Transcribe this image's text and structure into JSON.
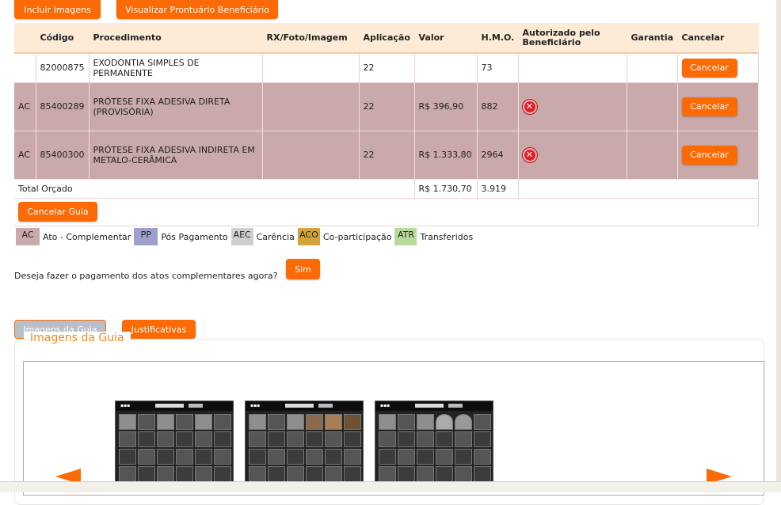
{
  "toolbar": {
    "incluir_imagens": "Incluir Imagens",
    "visualizar_prontuario": "Visualizar Prontuário Beneficiário"
  },
  "table": {
    "headers": [
      "",
      "Código",
      "Procedimento",
      "RX/Foto/Imagem",
      "Aplicação",
      "Valor",
      "H.M.O.",
      "Autorizado pelo Beneficiário",
      "Garantia",
      "Cancelar"
    ],
    "rows": [
      {
        "tipo": "",
        "codigo": "82000875",
        "procedimento": "EXODONTIA SIMPLES DE PERMANENTE",
        "rx": "",
        "aplicacao": "22",
        "valor": "",
        "hmo": "73",
        "garantia": "",
        "cancelar": "Cancelar"
      },
      {
        "tipo": "AC",
        "codigo": "85400289",
        "procedimento": "PRÓTESE FIXA ADESIVA DIRETA (PROVISÓRIA)",
        "rx": "",
        "aplicacao": "22",
        "valor": "R$ 396,90",
        "hmo": "882",
        "garantia": "",
        "cancelar": "Cancelar"
      },
      {
        "tipo": "AC",
        "codigo": "85400300",
        "procedimento": "PRÓTESE FIXA ADESIVA INDIRETA EM METALO-CERÂMICA",
        "rx": "",
        "aplicacao": "22",
        "valor": "R$ 1.333,80",
        "hmo": "2964",
        "garantia": "",
        "cancelar": "Cancelar"
      }
    ],
    "total_label": "Total Orçado",
    "total_valor": "R$ 1.730,70",
    "total_hmo": "3.919",
    "cancelar_guia": "Cancelar Guia"
  },
  "legend": [
    {
      "code": "AC",
      "label": "Ato - Complementar",
      "color": "#c9a9a9"
    },
    {
      "code": "PP",
      "label": "Pós Pagamento",
      "color": "#9d9fcf"
    },
    {
      "code": "AEC",
      "label": "Carência",
      "color": "#cfcfcf"
    },
    {
      "code": "ACO",
      "label": "Co-participação",
      "color": "#d2a43a"
    },
    {
      "code": "ATR",
      "label": "Transferidos",
      "color": "#b7da9b"
    }
  ],
  "question": {
    "text": "Deseja fazer o pagamento dos atos complementares agora?",
    "sim": "Sim"
  },
  "tabs": {
    "imagens": "Imagens da Guia",
    "justificativas": "Justificativas"
  },
  "panel": {
    "title": "Imagens da Guia"
  },
  "colors": {
    "accent": "#fb6a04",
    "ac_row": "#c9a9a9",
    "header": "#fdebd8",
    "panel_title": "#f08a1c"
  }
}
